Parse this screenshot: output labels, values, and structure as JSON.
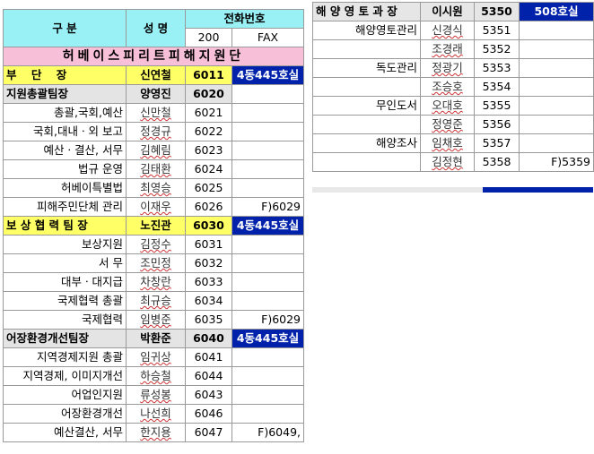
{
  "header": {
    "col1": "구   분",
    "col2": "성 명",
    "phone": "전화번호",
    "ext": "200",
    "fax": "FAX"
  },
  "title": "허베이스피리트피해지원단",
  "left_rows": [
    {
      "dept": "부  단  장",
      "name": "신연철",
      "ext": "6011",
      "fax": "4동445호실",
      "style": "yellow"
    },
    {
      "dept": "지원총괄팀장",
      "name": "양영진",
      "ext": "6020",
      "fax": "",
      "style": "grey"
    },
    {
      "dept": "총괄,국회,예산",
      "name": "신만철",
      "ext": "6021",
      "fax": "",
      "style": ""
    },
    {
      "dept": "국회,대내ㆍ외 보고",
      "name": "정경규",
      "ext": "6022",
      "fax": "",
      "style": ""
    },
    {
      "dept": "예산ㆍ결산, 서무",
      "name": "김혜림",
      "ext": "6023",
      "fax": "",
      "style": ""
    },
    {
      "dept": "법규 운영",
      "name": "김태환",
      "ext": "6024",
      "fax": "",
      "style": ""
    },
    {
      "dept": "허베이특별법",
      "name": "최영승",
      "ext": "6025",
      "fax": "",
      "style": ""
    },
    {
      "dept": "피해주민단체 관리",
      "name": "이재우",
      "ext": "6026",
      "fax": "F)6029",
      "style": ""
    },
    {
      "dept": "보 상 협 력 팀 장",
      "name": "노진관",
      "ext": "6030",
      "fax": "4동445호실",
      "style": "yellow"
    },
    {
      "dept": "보상지원",
      "name": "김정수",
      "ext": "6031",
      "fax": "",
      "style": ""
    },
    {
      "dept": "서    무",
      "name": "조민정",
      "ext": "6032",
      "fax": "",
      "style": ""
    },
    {
      "dept": "대부ㆍ대지급",
      "name": "차창란",
      "ext": "6033",
      "fax": "",
      "style": ""
    },
    {
      "dept": "국제협력 총괄",
      "name": "최규승",
      "ext": "6034",
      "fax": "",
      "style": ""
    },
    {
      "dept": "국제협력",
      "name": "임병준",
      "ext": "6035",
      "fax": "F)6029",
      "style": ""
    },
    {
      "dept": "어장환경개선팀장",
      "name": "박환준",
      "ext": "6040",
      "fax": "4동445호실",
      "style": "grey"
    },
    {
      "dept": "지역경제지원 총괄",
      "name": "임귀상",
      "ext": "6041",
      "fax": "",
      "style": ""
    },
    {
      "dept": "지역경제, 이미지개선",
      "name": "하승철",
      "ext": "6044",
      "fax": "",
      "style": ""
    },
    {
      "dept": "어업인지원",
      "name": "류성봉",
      "ext": "6043",
      "fax": "",
      "style": ""
    },
    {
      "dept": "어장환경개선",
      "name": "나선희",
      "ext": "6046",
      "fax": "",
      "style": ""
    },
    {
      "dept": "예산결산, 서무",
      "name": "한지용",
      "ext": "6047",
      "fax": "F)6049,",
      "style": ""
    }
  ],
  "right_rows": [
    {
      "dept": "해 양 영 토 과 장",
      "name": "이시원",
      "ext": "5350",
      "fax": "508호실",
      "style": "head"
    },
    {
      "dept": "해양영토관리",
      "name": "신경식",
      "ext": "5351",
      "fax": ""
    },
    {
      "dept": "",
      "name": "조경래",
      "ext": "5352",
      "fax": ""
    },
    {
      "dept": "독도관리",
      "name": "정광기",
      "ext": "5353",
      "fax": ""
    },
    {
      "dept": "",
      "name": "조승호",
      "ext": "5354",
      "fax": ""
    },
    {
      "dept": "무인도서",
      "name": "오대호",
      "ext": "5355",
      "fax": ""
    },
    {
      "dept": "",
      "name": "정영준",
      "ext": "5356",
      "fax": ""
    },
    {
      "dept": "해양조사",
      "name": "임채호",
      "ext": "5357",
      "fax": ""
    },
    {
      "dept": "",
      "name": "김정현",
      "ext": "5358",
      "fax": "F)5359"
    }
  ]
}
